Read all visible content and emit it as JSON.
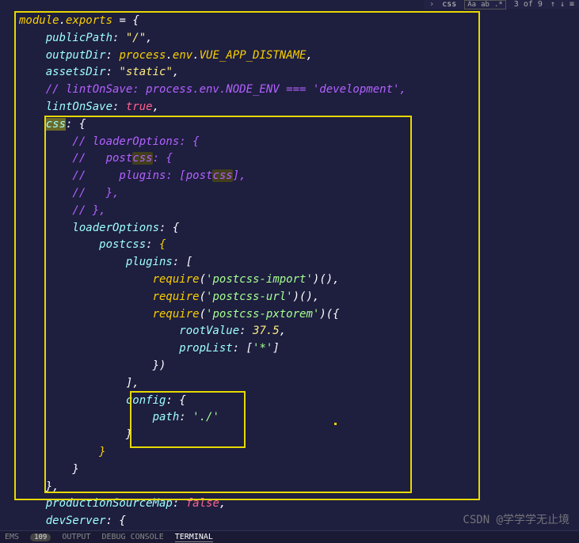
{
  "search": {
    "arrow": "›",
    "query": "css",
    "opt1": "Aa",
    "opt2": "ab",
    "opt3": ".*",
    "count": "3 of 9",
    "up": "↑",
    "down": "↓",
    "menu": "≡"
  },
  "code": {
    "l1": {
      "a": "module",
      "b": ".",
      "c": "exports",
      "d": " = {"
    },
    "l2": {
      "a": "    publicPath",
      "b": ": ",
      "c": "\"/\"",
      "d": ","
    },
    "l3": {
      "a": "    outputDir",
      "b": ": ",
      "c": "process",
      "d": ".",
      "e": "env",
      "f": ".",
      "g": "VUE_APP_DISTNAME",
      "h": ","
    },
    "l4": {
      "a": "    assetsDir",
      "b": ": ",
      "c": "\"static\"",
      "d": ","
    },
    "l5": {
      "a": "    // lintOnSave: process.env.NODE_ENV === 'development',"
    },
    "l6": {
      "a": "    lintOnSave",
      "b": ": ",
      "c": "true",
      "d": ","
    },
    "l7": {
      "a": "    ",
      "match": "css",
      "b": ": {"
    },
    "l8": {
      "a": "        // loaderOptions: {"
    },
    "l9": {
      "a": "        //   post",
      "match": "css",
      "b": ": {"
    },
    "l10": {
      "a": "        //     plugins: [post",
      "match": "css",
      "b": "],"
    },
    "l11": {
      "a": "        //   },"
    },
    "l12": {
      "a": "        // },"
    },
    "l13": {
      "a": "        loaderOptions",
      "b": ": {"
    },
    "l14": {
      "a": "            postcss",
      "b": ": ",
      "c": "{"
    },
    "l15": {
      "a": "                plugins",
      "b": ": ["
    },
    "l16": {
      "a": "                    ",
      "fn": "require",
      "b": "(",
      "str": "'postcss-import'",
      "c": ")(),"
    },
    "l17": {
      "a": "                    ",
      "fn": "require",
      "b": "(",
      "str": "'postcss-url'",
      "c": ")(),"
    },
    "l18": {
      "a": "                    ",
      "fn": "require",
      "b": "(",
      "str": "'postcss-pxtorem'",
      "c": ")({"
    },
    "l19": {
      "a": "                        rootValue",
      "b": ": ",
      "c": "37.5",
      "d": ","
    },
    "l20": {
      "a": "                        propList",
      "b": ": [",
      "c": "'*'",
      "d": "]"
    },
    "l21": {
      "a": "                    })"
    },
    "l22": {
      "a": "                ],"
    },
    "l23": {
      "a": "                config",
      "b": ": {"
    },
    "l24": {
      "a": "                    path",
      "b": ": ",
      "c": "'./'"
    },
    "l25": {
      "a": "                }"
    },
    "l26": {
      "a": "            ",
      "b": "}"
    },
    "l27": {
      "a": "        }"
    },
    "l28": {
      "a": "    },"
    },
    "l29": {
      "a": "    productionSourceMap",
      "b": ": ",
      "c": "false",
      "d": ","
    },
    "l30": {
      "a": "    devServer",
      "b": ": {"
    }
  },
  "panel": {
    "problems": "EMS",
    "badge": "109",
    "output": "OUTPUT",
    "debug": "DEBUG CONSOLE",
    "terminal": "TERMINAL"
  },
  "watermark": "CSDN @学学学无止境"
}
